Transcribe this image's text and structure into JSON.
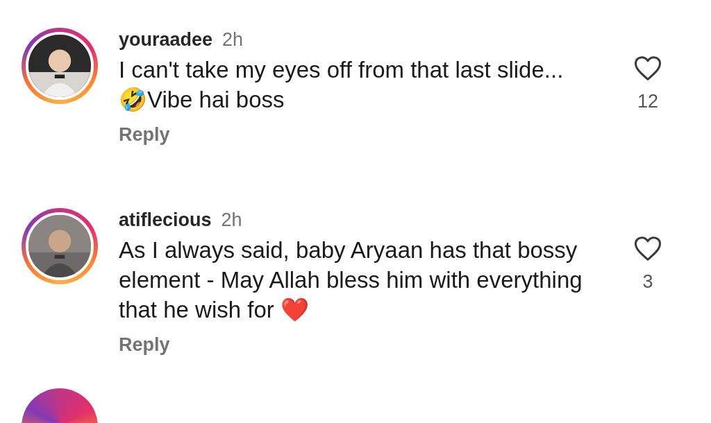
{
  "comments": [
    {
      "username": "youraadee",
      "time": "2h",
      "text": "I can't take my eyes off from that last slide... 🤣Vibe hai boss",
      "reply": "Reply",
      "liked": false,
      "likes": "12"
    },
    {
      "username": "atiflecious",
      "time": "2h",
      "text": "As I always said, baby Aryaan has that bossy element - May Allah bless him with everything that he wish for ❤️",
      "reply": "Reply",
      "liked": false,
      "likes": "3"
    }
  ]
}
